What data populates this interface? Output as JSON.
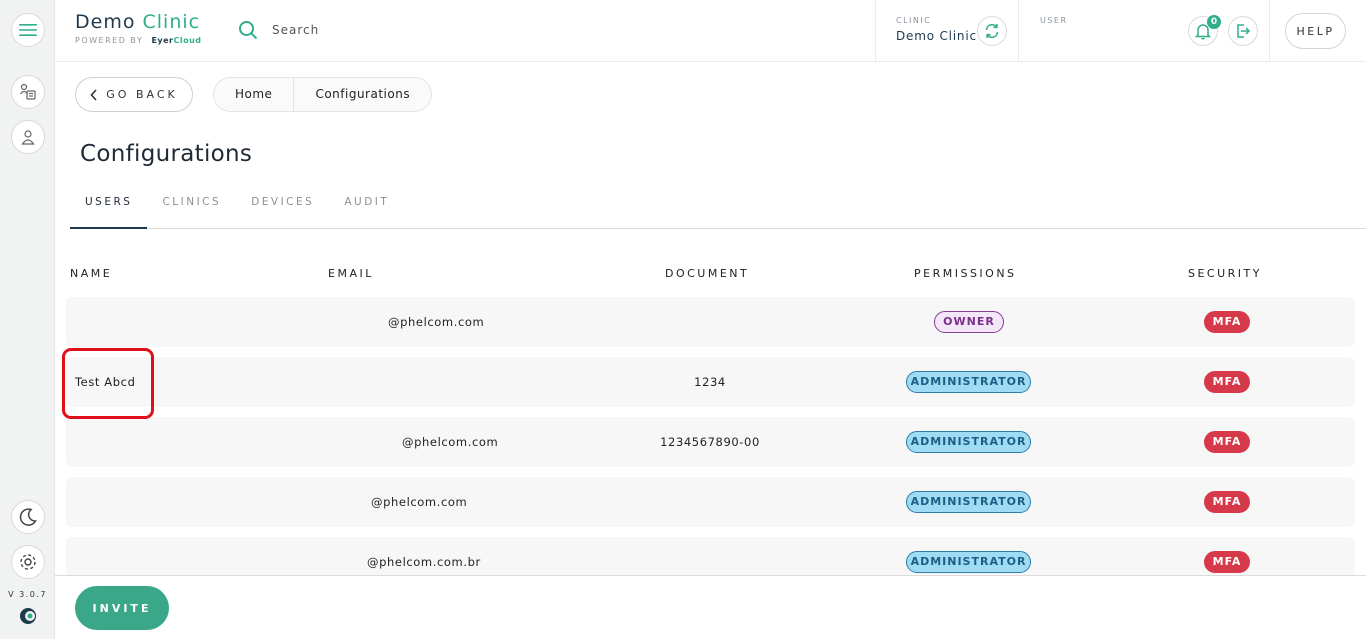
{
  "brand": {
    "title_main": "Demo",
    "title_accent": "Clinic",
    "powered_by": "POWERED BY",
    "product_main": "Eyer",
    "product_accent": "Cloud"
  },
  "search": {
    "label": "Search"
  },
  "clinic": {
    "caption": "CLINIC",
    "name": "Demo Clinic"
  },
  "user": {
    "caption": "USER"
  },
  "notifications": {
    "count": "0"
  },
  "help_label": "HELP",
  "sidebar": {
    "version": "V 3.0.7"
  },
  "nav": {
    "go_back": "GO BACK",
    "breadcrumbs": [
      "Home",
      "Configurations"
    ]
  },
  "page_title": "Configurations",
  "tabs": [
    "USERS",
    "CLINICS",
    "DEVICES",
    "AUDIT"
  ],
  "table": {
    "headers": [
      "NAME",
      "EMAIL",
      "DOCUMENT",
      "PERMISSIONS",
      "SECURITY"
    ],
    "rows": [
      {
        "name": "",
        "email": "@phelcom.com",
        "document": "",
        "permission": "OWNER",
        "security": "MFA"
      },
      {
        "name": "Test Abcd",
        "email": "",
        "document": "1234",
        "permission": "ADMINISTRATOR",
        "security": "MFA"
      },
      {
        "name": "",
        "email": "@phelcom.com",
        "document": "1234567890-00",
        "permission": "ADMINISTRATOR",
        "security": "MFA"
      },
      {
        "name": "",
        "email": "@phelcom.com",
        "document": "",
        "permission": "ADMINISTRATOR",
        "security": "MFA"
      },
      {
        "name": "",
        "email": "@phelcom.com.br",
        "document": "",
        "permission": "ADMINISTRATOR",
        "security": "MFA"
      }
    ]
  },
  "footer": {
    "invite_label": "INVITE"
  },
  "colors": {
    "accent": "#2fae8a",
    "owner_badge": "#7b2f8c",
    "admin_badge": "#9fdcf3",
    "mfa_badge": "#d63a4a",
    "highlight": "#e0101b"
  }
}
